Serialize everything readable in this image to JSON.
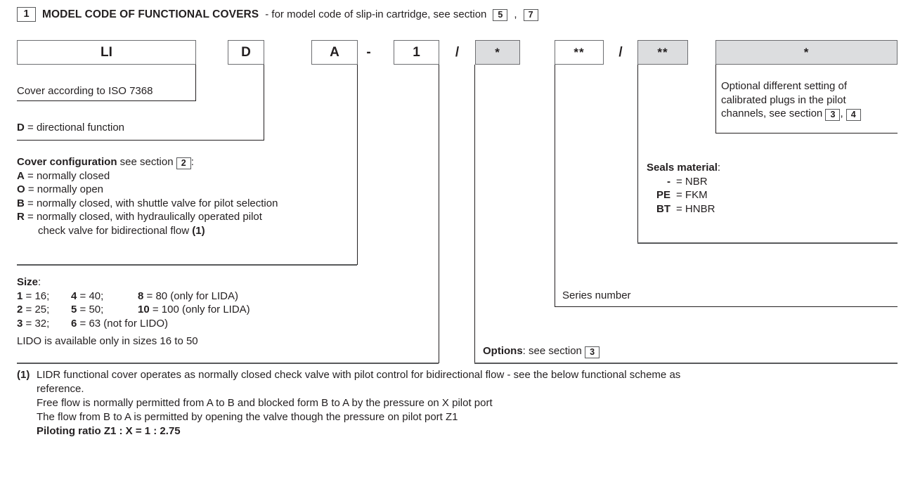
{
  "header": {
    "number": "1",
    "title": "MODEL CODE OF FUNCTIONAL COVERS",
    "rest_before_ref1": " - for model code of slip-in cartridge, see section ",
    "ref1": "5",
    "between_refs": ", ",
    "ref2": "7"
  },
  "code_boxes": [
    {
      "name": "prefix",
      "value": "LI"
    },
    {
      "name": "function",
      "value": "D"
    },
    {
      "name": "configuration",
      "value": "A"
    },
    {
      "name": "dash",
      "value": "-"
    },
    {
      "name": "size",
      "value": "1"
    },
    {
      "name": "slash1",
      "value": "/"
    },
    {
      "name": "options",
      "value": "*"
    },
    {
      "name": "series",
      "value": "**"
    },
    {
      "name": "slash2",
      "value": "/"
    },
    {
      "name": "seals",
      "value": "**"
    },
    {
      "name": "pilot-setting",
      "value": "*"
    }
  ],
  "left": {
    "cover_standard": "Cover according to ISO 7368",
    "directional": {
      "key": "D",
      "eq": " = ",
      "text": "directional function"
    },
    "cover_config": {
      "title": "Cover configuration",
      "see_section": " see section ",
      "ref": "2",
      "colon": ":",
      "items": [
        {
          "key": "A",
          "eq": " = ",
          "text": "normally closed"
        },
        {
          "key": "O",
          "eq": " = ",
          "text": "normally open"
        },
        {
          "key": "B",
          "eq": " = ",
          "text": "normally closed, with shuttle valve for pilot selection"
        },
        {
          "key": "R",
          "eq": " = ",
          "text": "normally  closed,  with  hydraulically  operated  pilot"
        }
      ],
      "item_r_line2": "check valve for bidirectional flow ",
      "item_r_note": "(1)"
    },
    "size": {
      "title": "Size",
      "colon": ":",
      "rows": [
        {
          "c1k": "1",
          "c1v": " = 16;",
          "c2k": "4",
          "c2v": " = 40;",
          "c3k": "8",
          "c3v": " = 80 (only for LIDA)"
        },
        {
          "c1k": "2",
          "c1v": " = 25;",
          "c2k": "5",
          "c2v": " = 50;",
          "c3k": "10",
          "c3v": " = 100 (only for LIDA)"
        },
        {
          "c1k": "3",
          "c1v": " = 32;",
          "c2k": "6",
          "c2v": " = 63 (not for LIDO)",
          "c3k": "",
          "c3v": ""
        }
      ],
      "note": "LIDO is available only in sizes 16 to 50"
    }
  },
  "right": {
    "pilot_setting": {
      "line1": "Optional different setting of",
      "line2": "calibrated plugs in the pilot",
      "line3_pre": "channels, see section ",
      "ref1": "3",
      "between": ", ",
      "ref2": "4"
    },
    "seals": {
      "title": "Seals material",
      "colon": ":",
      "items": [
        {
          "key": "-",
          "eq": "= NBR"
        },
        {
          "key": "PE",
          "eq": "= FKM"
        },
        {
          "key": "BT",
          "eq": "= HNBR"
        }
      ]
    },
    "series_number": "Series number",
    "options": {
      "title": "Options",
      "see_section": ": see section ",
      "ref": "3"
    }
  },
  "footnote": {
    "mark": "(1)",
    "line1": "LIDR functional cover operates as normally closed check valve with pilot control for bidirectional flow - see the below functional scheme as",
    "line2": "reference.",
    "line3": "Free flow is normally permitted from A to B and blocked form B to A by the pressure on X pilot port",
    "line4": "The flow from B to A is permitted by opening the valve though the pressure on pilot port Z1",
    "line5": "Piloting ratio Z1 : X = 1 : 2.75"
  },
  "colors": {
    "gray_box": "#dcdddf",
    "line": "#231f20",
    "border": "#6d6e71",
    "text": "#231f20"
  }
}
